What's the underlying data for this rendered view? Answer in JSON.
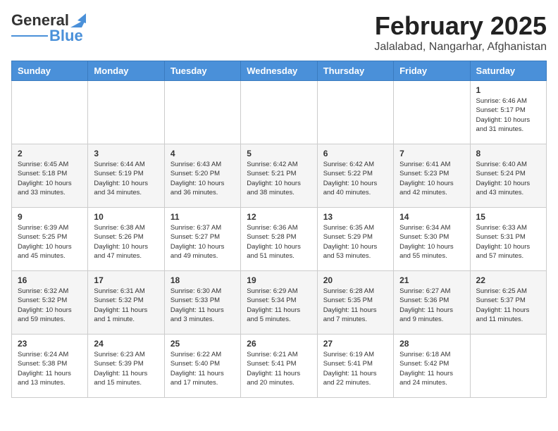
{
  "logo": {
    "line1": "General",
    "line2": "Blue"
  },
  "title": "February 2025",
  "subtitle": "Jalalabad, Nangarhar, Afghanistan",
  "days_of_week": [
    "Sunday",
    "Monday",
    "Tuesday",
    "Wednesday",
    "Thursday",
    "Friday",
    "Saturday"
  ],
  "weeks": [
    [
      {
        "day": "",
        "info": ""
      },
      {
        "day": "",
        "info": ""
      },
      {
        "day": "",
        "info": ""
      },
      {
        "day": "",
        "info": ""
      },
      {
        "day": "",
        "info": ""
      },
      {
        "day": "",
        "info": ""
      },
      {
        "day": "1",
        "info": "Sunrise: 6:46 AM\nSunset: 5:17 PM\nDaylight: 10 hours and 31 minutes."
      }
    ],
    [
      {
        "day": "2",
        "info": "Sunrise: 6:45 AM\nSunset: 5:18 PM\nDaylight: 10 hours and 33 minutes."
      },
      {
        "day": "3",
        "info": "Sunrise: 6:44 AM\nSunset: 5:19 PM\nDaylight: 10 hours and 34 minutes."
      },
      {
        "day": "4",
        "info": "Sunrise: 6:43 AM\nSunset: 5:20 PM\nDaylight: 10 hours and 36 minutes."
      },
      {
        "day": "5",
        "info": "Sunrise: 6:42 AM\nSunset: 5:21 PM\nDaylight: 10 hours and 38 minutes."
      },
      {
        "day": "6",
        "info": "Sunrise: 6:42 AM\nSunset: 5:22 PM\nDaylight: 10 hours and 40 minutes."
      },
      {
        "day": "7",
        "info": "Sunrise: 6:41 AM\nSunset: 5:23 PM\nDaylight: 10 hours and 42 minutes."
      },
      {
        "day": "8",
        "info": "Sunrise: 6:40 AM\nSunset: 5:24 PM\nDaylight: 10 hours and 43 minutes."
      }
    ],
    [
      {
        "day": "9",
        "info": "Sunrise: 6:39 AM\nSunset: 5:25 PM\nDaylight: 10 hours and 45 minutes."
      },
      {
        "day": "10",
        "info": "Sunrise: 6:38 AM\nSunset: 5:26 PM\nDaylight: 10 hours and 47 minutes."
      },
      {
        "day": "11",
        "info": "Sunrise: 6:37 AM\nSunset: 5:27 PM\nDaylight: 10 hours and 49 minutes."
      },
      {
        "day": "12",
        "info": "Sunrise: 6:36 AM\nSunset: 5:28 PM\nDaylight: 10 hours and 51 minutes."
      },
      {
        "day": "13",
        "info": "Sunrise: 6:35 AM\nSunset: 5:29 PM\nDaylight: 10 hours and 53 minutes."
      },
      {
        "day": "14",
        "info": "Sunrise: 6:34 AM\nSunset: 5:30 PM\nDaylight: 10 hours and 55 minutes."
      },
      {
        "day": "15",
        "info": "Sunrise: 6:33 AM\nSunset: 5:31 PM\nDaylight: 10 hours and 57 minutes."
      }
    ],
    [
      {
        "day": "16",
        "info": "Sunrise: 6:32 AM\nSunset: 5:32 PM\nDaylight: 10 hours and 59 minutes."
      },
      {
        "day": "17",
        "info": "Sunrise: 6:31 AM\nSunset: 5:32 PM\nDaylight: 11 hours and 1 minute."
      },
      {
        "day": "18",
        "info": "Sunrise: 6:30 AM\nSunset: 5:33 PM\nDaylight: 11 hours and 3 minutes."
      },
      {
        "day": "19",
        "info": "Sunrise: 6:29 AM\nSunset: 5:34 PM\nDaylight: 11 hours and 5 minutes."
      },
      {
        "day": "20",
        "info": "Sunrise: 6:28 AM\nSunset: 5:35 PM\nDaylight: 11 hours and 7 minutes."
      },
      {
        "day": "21",
        "info": "Sunrise: 6:27 AM\nSunset: 5:36 PM\nDaylight: 11 hours and 9 minutes."
      },
      {
        "day": "22",
        "info": "Sunrise: 6:25 AM\nSunset: 5:37 PM\nDaylight: 11 hours and 11 minutes."
      }
    ],
    [
      {
        "day": "23",
        "info": "Sunrise: 6:24 AM\nSunset: 5:38 PM\nDaylight: 11 hours and 13 minutes."
      },
      {
        "day": "24",
        "info": "Sunrise: 6:23 AM\nSunset: 5:39 PM\nDaylight: 11 hours and 15 minutes."
      },
      {
        "day": "25",
        "info": "Sunrise: 6:22 AM\nSunset: 5:40 PM\nDaylight: 11 hours and 17 minutes."
      },
      {
        "day": "26",
        "info": "Sunrise: 6:21 AM\nSunset: 5:41 PM\nDaylight: 11 hours and 20 minutes."
      },
      {
        "day": "27",
        "info": "Sunrise: 6:19 AM\nSunset: 5:41 PM\nDaylight: 11 hours and 22 minutes."
      },
      {
        "day": "28",
        "info": "Sunrise: 6:18 AM\nSunset: 5:42 PM\nDaylight: 11 hours and 24 minutes."
      },
      {
        "day": "",
        "info": ""
      }
    ]
  ]
}
